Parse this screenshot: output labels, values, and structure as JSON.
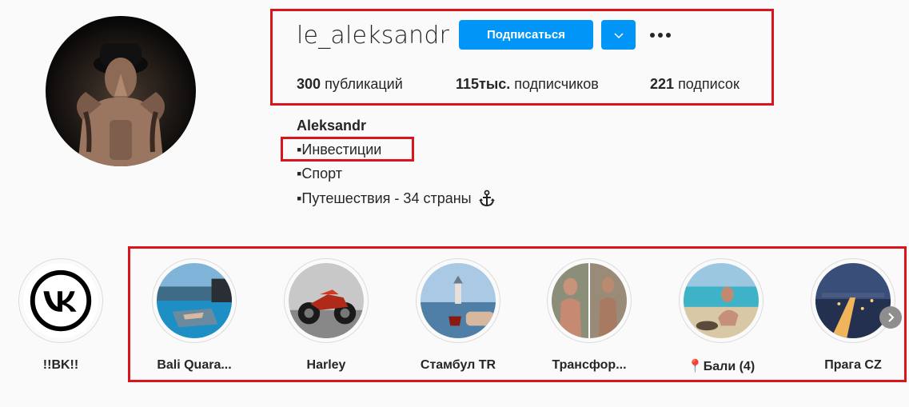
{
  "profile": {
    "username": "le_aleksandr",
    "follow_label": "Подписаться",
    "stats": {
      "posts_count": "300",
      "posts_label": "публикаций",
      "followers_count": "115тыс.",
      "followers_label": "подписчиков",
      "following_count": "221",
      "following_label": "подписок"
    },
    "bio": {
      "name": "Aleksandr",
      "lines": [
        "▪Инвестиции",
        "▪Спорт",
        "▪Путешествия - 34 страны"
      ]
    }
  },
  "stories": [
    {
      "label": "!!BK!!",
      "icon": "vk-logo"
    },
    {
      "label": "Bali Quara..."
    },
    {
      "label": "Harley"
    },
    {
      "label": "Стамбул TR"
    },
    {
      "label": "Трансфор..."
    },
    {
      "label": "📍Бали (4)"
    },
    {
      "label": "Прага CZ"
    }
  ],
  "colors": {
    "accent": "#0095f6",
    "highlight_box": "#d9141c",
    "background": "#fafafa"
  }
}
